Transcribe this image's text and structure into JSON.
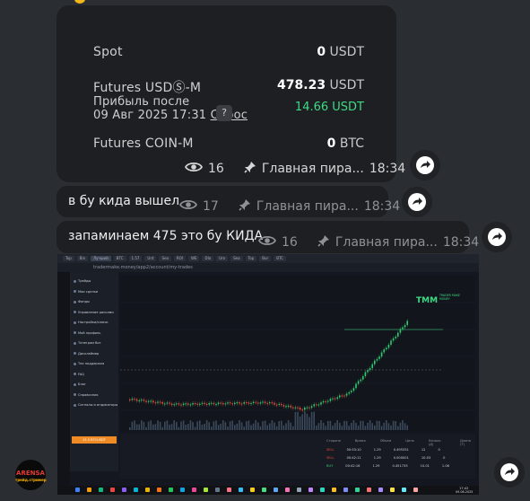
{
  "balance_card": {
    "spot_label": "Spot",
    "spot_amount": "0",
    "spot_currency": "USDT",
    "futures_usds_label": "Futures USDⓈ-M",
    "futures_usds_amount": "478.23",
    "futures_usds_currency": "USDT",
    "profit_label_line1": "Прибыль после",
    "profit_label_line2": "09 Авг 2025 17:31",
    "profit_reset": "Сброс",
    "profit_help": "?",
    "profit_value": "14.66 USDT",
    "futures_coin_label": "Futures COIN-M",
    "futures_coin_amount": "0",
    "futures_coin_currency": "BTC"
  },
  "messages": [
    {
      "views": "16",
      "channel": "Главная пира...",
      "time": "18:34"
    },
    {
      "text": "в бу кида вышел",
      "views": "17",
      "channel": "Главная пира...",
      "time": "18:34"
    },
    {
      "text": "запаминаем 475 это бу КИДА",
      "views": "16",
      "channel": "Главная пира...",
      "time": "18:34"
    }
  ],
  "screenshot": {
    "tabs": [
      "Top",
      "Bin",
      "Лучший",
      "BTC",
      "1.57",
      "Unt",
      "Sea",
      "ROI",
      "WE",
      "Dla",
      "Uro",
      "Sea",
      "Top",
      "Bur",
      "BTC"
    ],
    "url": "tradermake.money/app2/account/my-trades",
    "nav_items": [
      "Трейды",
      "Мои сделки",
      "Фонды",
      "Управление рисками",
      "Настройки/ключи",
      "Мой профиль",
      "Телеграм бот",
      "Дисклеймер",
      "Тех поддержка",
      "FAQ",
      "Блог",
      "Справочник",
      "Сигналы и индикаторы"
    ],
    "logo_text": "TRADER MAKE MONEY",
    "footer_price": "15.5 BTCUSDT",
    "table_headers": [
      "Сторона",
      "Время",
      "Объем",
      "Цена",
      "Начало (Д)",
      "Длина (Т)"
    ],
    "table_rows": [
      [
        "SELL",
        "00:53:10",
        "1.29",
        "0.495331",
        "12",
        "0"
      ],
      [
        "SELL",
        "00:42:11",
        "1.29",
        "0.000001",
        "10.03",
        "0"
      ],
      [
        "BUY",
        "00:42:16",
        "1.29",
        "0.451735",
        "10.01",
        "1.06"
      ]
    ],
    "taskbar_time": "17:42",
    "taskbar_date": "09.08.2025"
  },
  "overlay_logo": {
    "line1": "ARENSA",
    "line2": "трейд.стример"
  },
  "colors": {
    "bubble": "#1d1f23",
    "background": "#2a2d31",
    "profit": "#3ddc84",
    "accent_orange": "#f08a24"
  }
}
